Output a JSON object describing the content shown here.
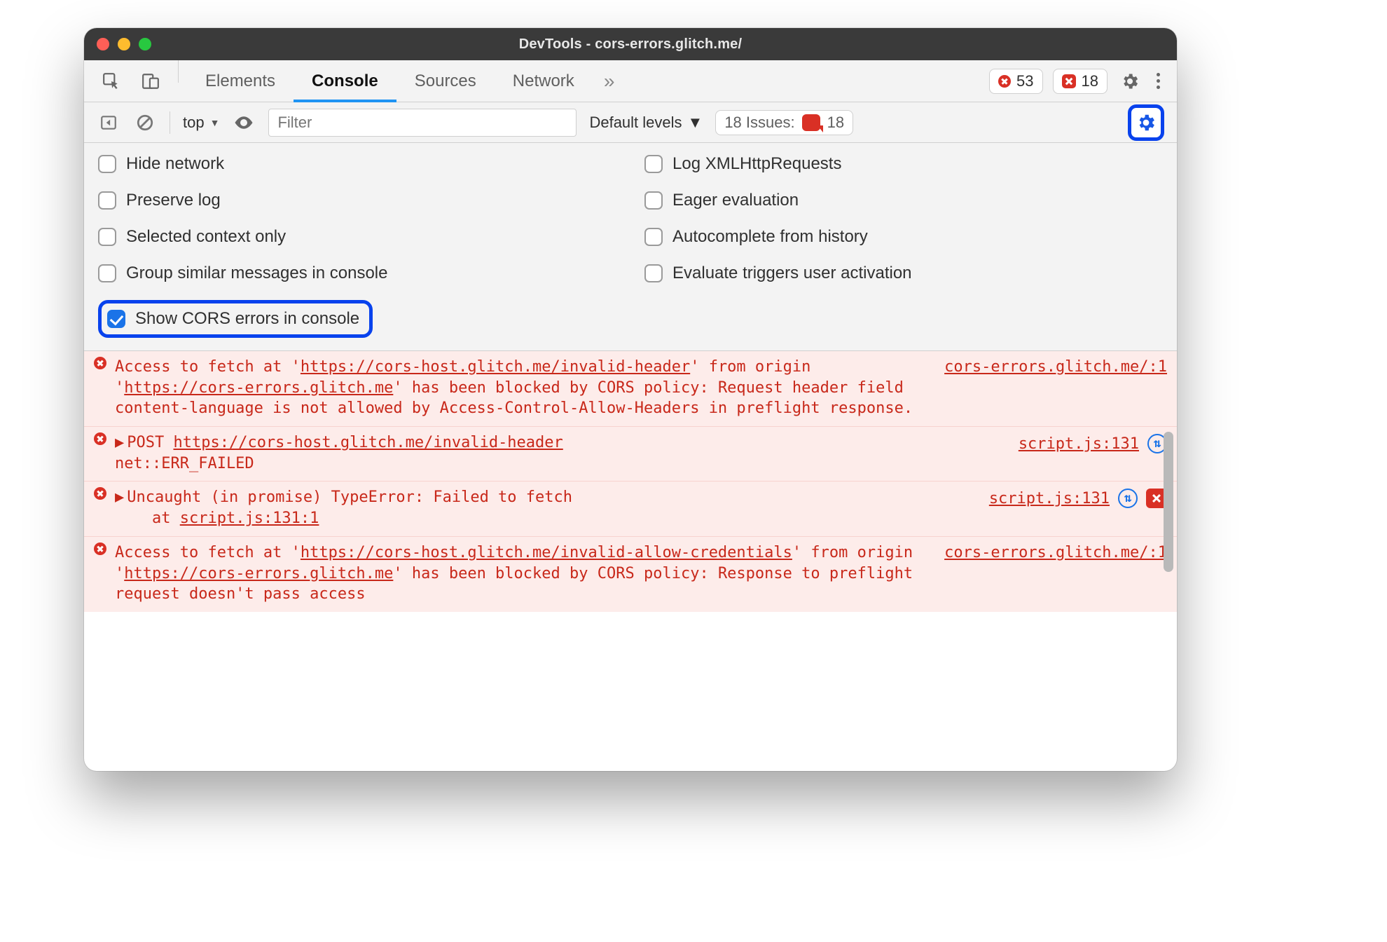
{
  "window": {
    "title": "DevTools - cors-errors.glitch.me/"
  },
  "tabs": {
    "items": [
      "Elements",
      "Console",
      "Sources",
      "Network"
    ],
    "active_index": 1,
    "overflow_glyph": "»"
  },
  "tabbar_badges": {
    "errors_count": "53",
    "issues_count": "18"
  },
  "toolbar": {
    "context_label": "top",
    "filter_placeholder": "Filter",
    "levels_label": "Default levels",
    "issues_label": "18 Issues:",
    "issues_badge_count": "18"
  },
  "settings": {
    "left": [
      {
        "label": "Hide network",
        "checked": false
      },
      {
        "label": "Preserve log",
        "checked": false
      },
      {
        "label": "Selected context only",
        "checked": false
      },
      {
        "label": "Group similar messages in console",
        "checked": false
      },
      {
        "label": "Show CORS errors in console",
        "checked": true,
        "highlighted": true
      }
    ],
    "right": [
      {
        "label": "Log XMLHttpRequests",
        "checked": false
      },
      {
        "label": "Eager evaluation",
        "checked": false
      },
      {
        "label": "Autocomplete from history",
        "checked": false
      },
      {
        "label": "Evaluate triggers user activation",
        "checked": false
      }
    ]
  },
  "logs": [
    {
      "kind": "cors",
      "prefix": "Access to fetch at '",
      "url1": "https://cors-host.glitch.me/invalid-header",
      "mid": "' from origin '",
      "url2": "https://cors-errors.glitch.me",
      "suffix": "' has been blocked by CORS policy: Request header field content-language is not allowed by Access-Control-Allow-Headers in preflight response.",
      "source": "cors-errors.glitch.me/:1"
    },
    {
      "kind": "net",
      "method": "POST",
      "url": "https://cors-host.glitch.me/invalid-header",
      "status": "net::ERR_FAILED",
      "source": "script.js:131",
      "has_net_icon": true
    },
    {
      "kind": "exc",
      "line1": "Uncaught (in promise) TypeError: Failed to fetch",
      "line2_label": "at ",
      "line2_link": "script.js:131:1",
      "source": "script.js:131",
      "has_net_icon": true,
      "has_issue_chip": true
    },
    {
      "kind": "cors",
      "prefix": "Access to fetch at '",
      "url1": "https://cors-host.glitch.me/invalid-allow-credentials",
      "mid": "' from origin '",
      "url2": "https://cors-errors.glitch.me",
      "suffix": "' has been blocked by CORS policy: Response to preflight request doesn't pass access",
      "source": "cors-errors.glitch.me/:1"
    }
  ]
}
